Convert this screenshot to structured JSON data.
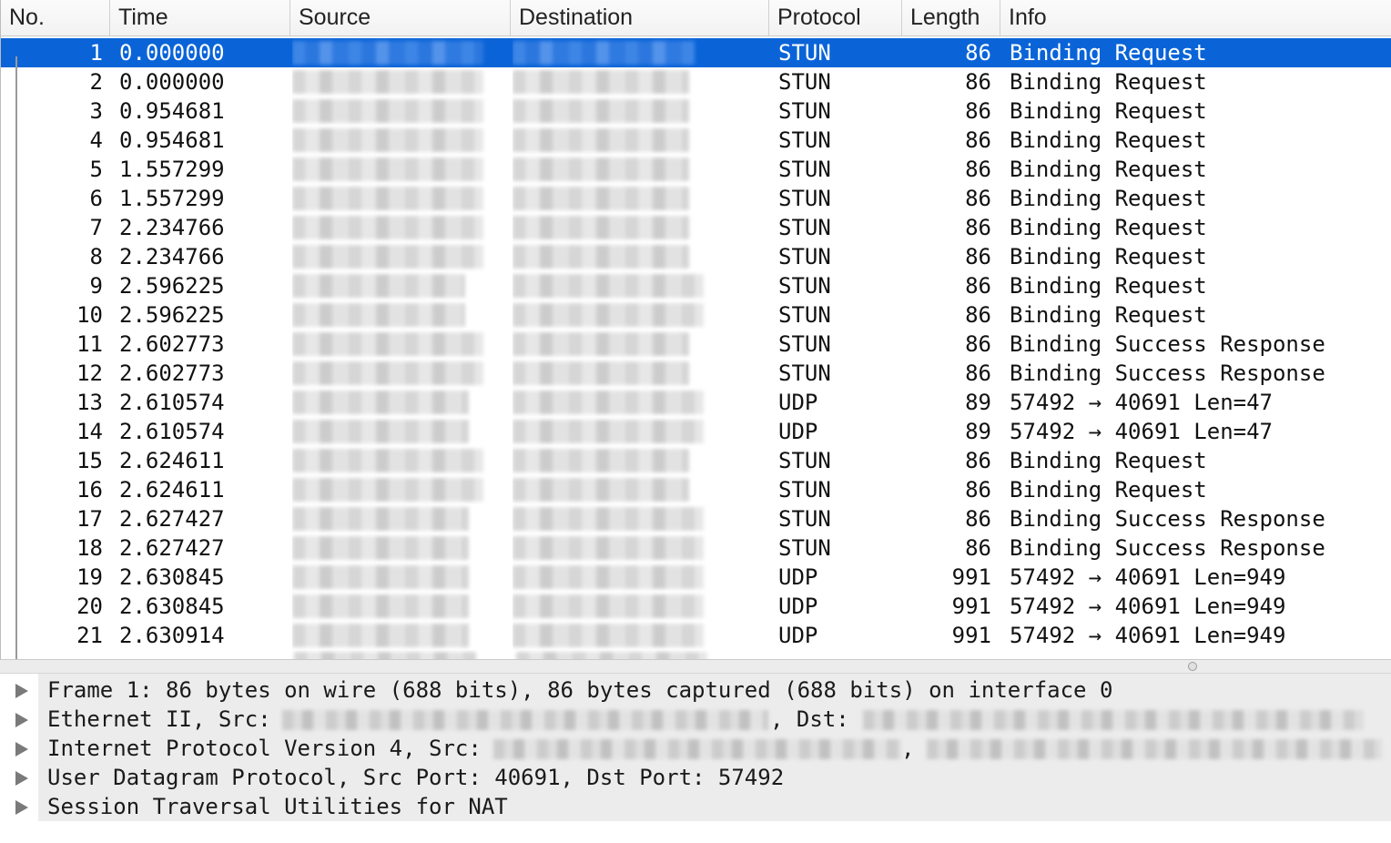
{
  "columns": {
    "no": "No.",
    "time": "Time",
    "source": "Source",
    "destination": "Destination",
    "protocol": "Protocol",
    "length": "Length",
    "info": "Info"
  },
  "packets": [
    {
      "no": "1",
      "time": "0.000000",
      "protocol": "STUN",
      "length": "86",
      "info": "Binding Request"
    },
    {
      "no": "2",
      "time": "0.000000",
      "protocol": "STUN",
      "length": "86",
      "info": "Binding Request"
    },
    {
      "no": "3",
      "time": "0.954681",
      "protocol": "STUN",
      "length": "86",
      "info": "Binding Request"
    },
    {
      "no": "4",
      "time": "0.954681",
      "protocol": "STUN",
      "length": "86",
      "info": "Binding Request"
    },
    {
      "no": "5",
      "time": "1.557299",
      "protocol": "STUN",
      "length": "86",
      "info": "Binding Request"
    },
    {
      "no": "6",
      "time": "1.557299",
      "protocol": "STUN",
      "length": "86",
      "info": "Binding Request"
    },
    {
      "no": "7",
      "time": "2.234766",
      "protocol": "STUN",
      "length": "86",
      "info": "Binding Request"
    },
    {
      "no": "8",
      "time": "2.234766",
      "protocol": "STUN",
      "length": "86",
      "info": "Binding Request"
    },
    {
      "no": "9",
      "time": "2.596225",
      "protocol": "STUN",
      "length": "86",
      "info": "Binding Request"
    },
    {
      "no": "10",
      "time": "2.596225",
      "protocol": "STUN",
      "length": "86",
      "info": "Binding Request"
    },
    {
      "no": "11",
      "time": "2.602773",
      "protocol": "STUN",
      "length": "86",
      "info": "Binding Success Response"
    },
    {
      "no": "12",
      "time": "2.602773",
      "protocol": "STUN",
      "length": "86",
      "info": "Binding Success Response"
    },
    {
      "no": "13",
      "time": "2.610574",
      "protocol": "UDP",
      "length": "89",
      "info": "57492 → 40691 Len=47"
    },
    {
      "no": "14",
      "time": "2.610574",
      "protocol": "UDP",
      "length": "89",
      "info": "57492 → 40691 Len=47"
    },
    {
      "no": "15",
      "time": "2.624611",
      "protocol": "STUN",
      "length": "86",
      "info": "Binding Request"
    },
    {
      "no": "16",
      "time": "2.624611",
      "protocol": "STUN",
      "length": "86",
      "info": "Binding Request"
    },
    {
      "no": "17",
      "time": "2.627427",
      "protocol": "STUN",
      "length": "86",
      "info": "Binding Success Response"
    },
    {
      "no": "18",
      "time": "2.627427",
      "protocol": "STUN",
      "length": "86",
      "info": "Binding Success Response"
    },
    {
      "no": "19",
      "time": "2.630845",
      "protocol": "UDP",
      "length": "991",
      "info": "57492 → 40691 Len=949"
    },
    {
      "no": "20",
      "time": "2.630845",
      "protocol": "UDP",
      "length": "991",
      "info": "57492 → 40691 Len=949"
    },
    {
      "no": "21",
      "time": "2.630914",
      "protocol": "UDP",
      "length": "991",
      "info": "57492 → 40691 Len=949"
    }
  ],
  "details": {
    "frame": "Frame 1: 86 bytes on wire (688 bits), 86 bytes captured (688 bits) on interface 0",
    "ethernet_src_label": "Ethernet II, Src: ",
    "ethernet_dst_label": ", Dst: ",
    "ip_src_label": "Internet Protocol Version 4, Src: ",
    "ip_sep": ",",
    "udp": "User Datagram Protocol, Src Port: 40691, Dst Port: 57492",
    "stun": "Session Traversal Utilities for NAT"
  },
  "colors": {
    "selection": "#0a64d8",
    "header_bg": "#f6f6f6",
    "details_bg": "#ececec"
  }
}
